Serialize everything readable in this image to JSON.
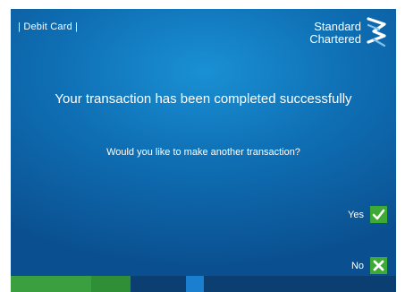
{
  "header": {
    "card_label": "| Debit Card |",
    "brand_line1": "Standard",
    "brand_line2": "Chartered"
  },
  "main": {
    "headline": "Your transaction has been completed successfully",
    "question": "Would you like to make another transaction?"
  },
  "options": {
    "yes_label": "Yes",
    "yes_icon": "checkmark-icon",
    "no_label": "No",
    "no_icon": "cross-icon"
  },
  "colors": {
    "background": "#0f6fb4",
    "option_green": "#3daa35",
    "bottom_bar": [
      "#3a9f3f",
      "#2f8f36",
      "#0b3f72",
      "#1a7fcf",
      "#0b3f72"
    ]
  }
}
